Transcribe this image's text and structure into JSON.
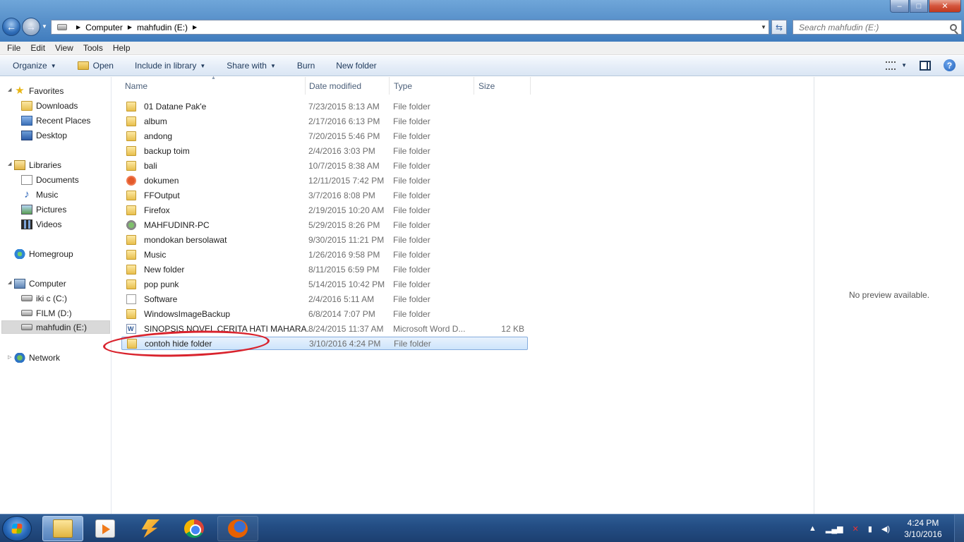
{
  "window": {
    "controls": {
      "minimize": "–",
      "maximize": "□",
      "close": "✕"
    },
    "address": {
      "crumbs": [
        "Computer",
        "mahfudin (E:)"
      ]
    },
    "search_placeholder": "Search mahfudin (E:)"
  },
  "menu": [
    "File",
    "Edit",
    "View",
    "Tools",
    "Help"
  ],
  "toolbar": {
    "organize": "Organize",
    "open": "Open",
    "include_in_library": "Include in library",
    "share_with": "Share with",
    "burn": "Burn",
    "new_folder": "New folder"
  },
  "nav": {
    "favorites": "Favorites",
    "downloads": "Downloads",
    "recent_places": "Recent Places",
    "desktop": "Desktop",
    "libraries": "Libraries",
    "documents": "Documents",
    "music": "Music",
    "pictures": "Pictures",
    "videos": "Videos",
    "homegroup": "Homegroup",
    "computer": "Computer",
    "drive_c": "iki c (C:)",
    "drive_d": "FILM (D:)",
    "drive_e": "mahfudin (E:)",
    "network": "Network"
  },
  "columns": {
    "name": "Name",
    "date": "Date modified",
    "type": "Type",
    "size": "Size"
  },
  "files": [
    {
      "name": "01 Datane Pak'e",
      "date": "7/23/2015 8:13 AM",
      "type": "File folder",
      "size": "",
      "icon": "folder"
    },
    {
      "name": "album",
      "date": "2/17/2016 6:13 PM",
      "type": "File folder",
      "size": "",
      "icon": "folder"
    },
    {
      "name": "andong",
      "date": "7/20/2015 5:46 PM",
      "type": "File folder",
      "size": "",
      "icon": "folder"
    },
    {
      "name": "backup toim",
      "date": "2/4/2016 3:03 PM",
      "type": "File folder",
      "size": "",
      "icon": "folder"
    },
    {
      "name": "bali",
      "date": "10/7/2015 8:38 AM",
      "type": "File folder",
      "size": "",
      "icon": "folder"
    },
    {
      "name": "dokumen",
      "date": "12/11/2015 7:42 PM",
      "type": "File folder",
      "size": "",
      "icon": "opera"
    },
    {
      "name": "FFOutput",
      "date": "3/7/2016 8:08 PM",
      "type": "File folder",
      "size": "",
      "icon": "folder"
    },
    {
      "name": "Firefox",
      "date": "2/19/2015 10:20 AM",
      "type": "File folder",
      "size": "",
      "icon": "folder"
    },
    {
      "name": "MAHFUDINR-PC",
      "date": "5/29/2015 8:26 PM",
      "type": "File folder",
      "size": "",
      "icon": "pc"
    },
    {
      "name": "mondokan bersolawat",
      "date": "9/30/2015 11:21 PM",
      "type": "File folder",
      "size": "",
      "icon": "folder"
    },
    {
      "name": "Music",
      "date": "1/26/2016 9:58 PM",
      "type": "File folder",
      "size": "",
      "icon": "folder"
    },
    {
      "name": "New folder",
      "date": "8/11/2015 6:59 PM",
      "type": "File folder",
      "size": "",
      "icon": "folder"
    },
    {
      "name": "pop punk",
      "date": "5/14/2015 10:42 PM",
      "type": "File folder",
      "size": "",
      "icon": "folder"
    },
    {
      "name": "Software",
      "date": "2/4/2016 5:11 AM",
      "type": "File folder",
      "size": "",
      "icon": "file"
    },
    {
      "name": "WindowsImageBackup",
      "date": "6/8/2014 7:07 PM",
      "type": "File folder",
      "size": "",
      "icon": "folder"
    },
    {
      "name": "SINOPSIS NOVEL CERITA HATI MAHARA...",
      "date": "8/24/2015 11:37 AM",
      "type": "Microsoft Word D...",
      "size": "12 KB",
      "icon": "word"
    },
    {
      "name": "contoh hide folder",
      "date": "3/10/2016 4:24 PM",
      "type": "File folder",
      "size": "",
      "icon": "folder",
      "selected": true
    }
  ],
  "preview": {
    "message": "No preview available."
  },
  "taskbar": {
    "apps": [
      "windows-explorer",
      "media-player",
      "winamp",
      "chrome",
      "firefox"
    ],
    "clock_time": "4:24 PM",
    "clock_date": "3/10/2016"
  },
  "colors": {
    "selection": "#cde4fb",
    "annotation": "#d9232d",
    "taskbar": "#244e85"
  }
}
